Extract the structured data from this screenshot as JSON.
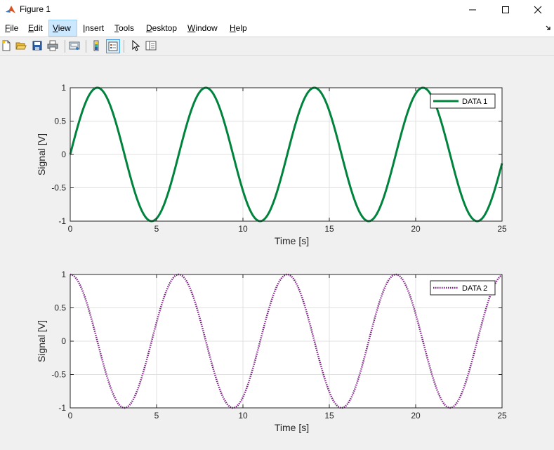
{
  "window": {
    "title": "Figure 1",
    "minimize": "minimize",
    "maximize": "maximize",
    "close": "close"
  },
  "menu": {
    "items": [
      {
        "label": "File",
        "active": false
      },
      {
        "label": "Edit",
        "active": false
      },
      {
        "label": "View",
        "active": true
      },
      {
        "label": "Insert",
        "active": false
      },
      {
        "label": "Tools",
        "active": false
      },
      {
        "label": "Desktop",
        "active": false
      },
      {
        "label": "Window",
        "active": false
      },
      {
        "label": "Help",
        "active": false
      }
    ]
  },
  "toolbar": {
    "buttons": [
      {
        "name": "new-figure-icon"
      },
      {
        "name": "open-file-icon"
      },
      {
        "name": "save-icon"
      },
      {
        "name": "print-icon"
      },
      {
        "name": "link-plot-icon"
      },
      {
        "name": "insert-colorbar-icon"
      },
      {
        "name": "insert-legend-icon",
        "pressed": true
      },
      {
        "name": "edit-plot-pointer-icon"
      },
      {
        "name": "property-inspector-icon"
      }
    ]
  },
  "colors": {
    "series1": "#00843d",
    "series2": "#7e1f86",
    "axes_bg": "#ffffff",
    "grid": "#e0e0e0",
    "figure_bg": "#f0f0f0"
  },
  "chart_data": [
    {
      "type": "line",
      "function": "sin(t)",
      "x_range": [
        0,
        25
      ],
      "xlim": [
        0,
        25
      ],
      "ylim": [
        -1,
        1
      ],
      "xticks": [
        0,
        5,
        10,
        15,
        20,
        25
      ],
      "yticks": [
        -1,
        -0.5,
        0,
        0.5,
        1
      ],
      "xtick_labels": [
        "0",
        "5",
        "10",
        "15",
        "20",
        "25"
      ],
      "ytick_labels": [
        "-1",
        "-0.5",
        "0",
        "0.5",
        "1"
      ],
      "xlabel": "Time [s]",
      "ylabel": "Signal [V]",
      "grid": true,
      "legend_position": "top-right",
      "series": [
        {
          "name": "DATA 1",
          "line_style": "solid",
          "color": "#00843d"
        }
      ]
    },
    {
      "type": "line",
      "function": "cos(t)",
      "x_range": [
        0,
        25
      ],
      "xlim": [
        0,
        25
      ],
      "ylim": [
        -1,
        1
      ],
      "xticks": [
        0,
        5,
        10,
        15,
        20,
        25
      ],
      "yticks": [
        -1,
        -0.5,
        0,
        0.5,
        1
      ],
      "xtick_labels": [
        "0",
        "5",
        "10",
        "15",
        "20",
        "25"
      ],
      "ytick_labels": [
        "-1",
        "-0.5",
        "0",
        "0.5",
        "1"
      ],
      "xlabel": "Time [s]",
      "ylabel": "Signal [V]",
      "grid": true,
      "legend_position": "top-right",
      "series": [
        {
          "name": "DATA 2",
          "line_style": "dotted",
          "color": "#7e1f86"
        }
      ]
    }
  ]
}
